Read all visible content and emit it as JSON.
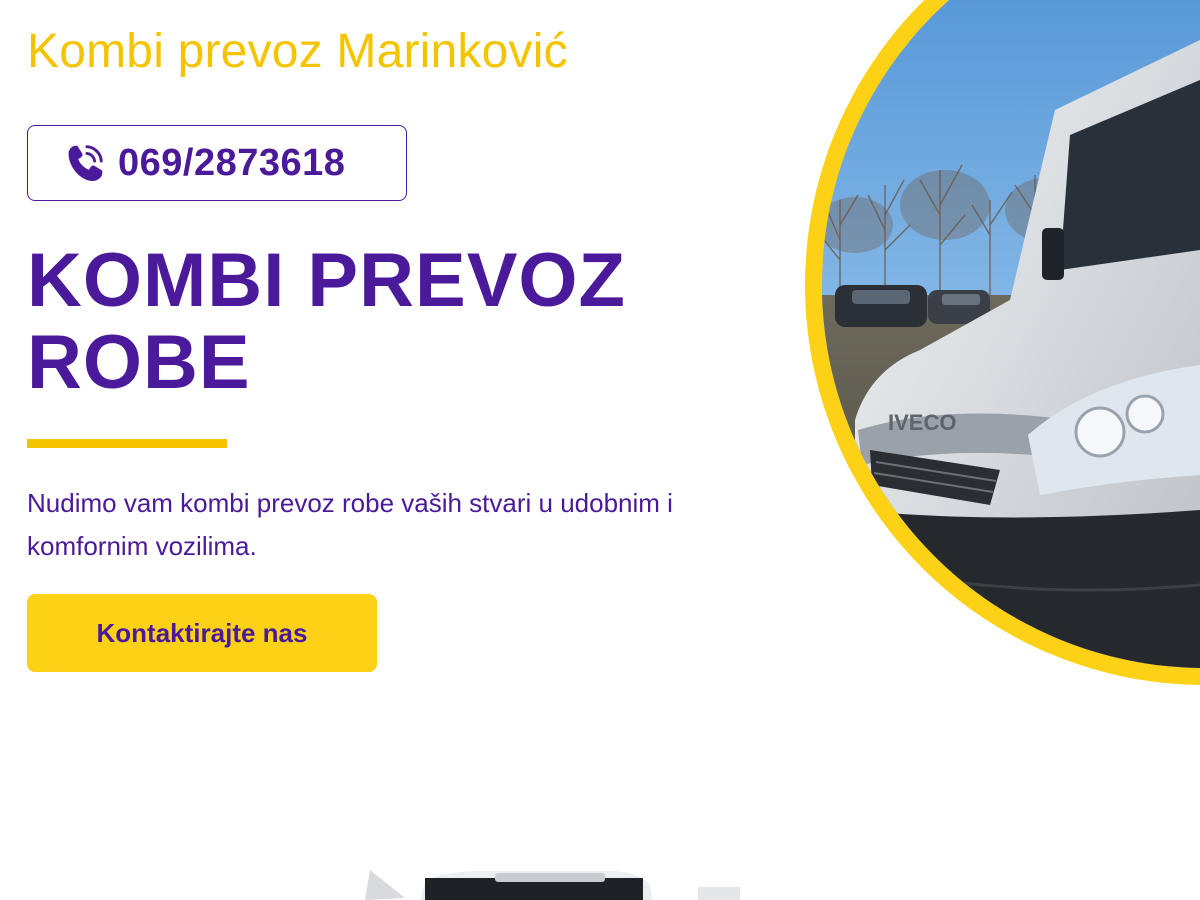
{
  "header": {
    "site_title": "Kombi prevoz Marinković"
  },
  "contact": {
    "phone": "069/2873618",
    "phone_icon": "phone-ringing-icon"
  },
  "hero": {
    "title_line1": "KOMBI PREVOZ",
    "title_line2": "ROBE",
    "description": "Nudimo vam kombi prevoz robe vaših stvari u udobnim i komfornim vozilima.",
    "cta_label": "Kontaktirajte nas",
    "van_badge": "IVECO"
  },
  "colors": {
    "brand_purple": "#4a1a9b",
    "accent_yellow": "#f5c400",
    "button_yellow": "#fcd116",
    "background": "#ffffff"
  }
}
